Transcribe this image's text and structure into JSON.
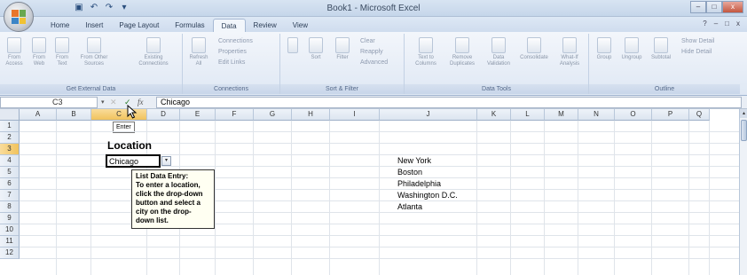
{
  "window": {
    "title": "Book1 - Microsoft Excel",
    "controls": [
      "–",
      "□",
      "x"
    ]
  },
  "quick_access": [
    {
      "icon": "save-icon",
      "glyph": "▣"
    },
    {
      "icon": "undo-icon",
      "glyph": "↶"
    },
    {
      "icon": "redo-icon",
      "glyph": "↷"
    },
    {
      "icon": "customize-icon",
      "glyph": "▾"
    }
  ],
  "tabs": [
    "Home",
    "Insert",
    "Page Layout",
    "Formulas",
    "Data",
    "Review",
    "View"
  ],
  "active_tab": "Data",
  "help_controls": [
    "?",
    "–",
    "□",
    "x"
  ],
  "ribbon": {
    "get_external": {
      "label": "Get External Data",
      "buttons": [
        "From Access",
        "From Web",
        "From Text",
        "From Other Sources",
        "Existing Connections"
      ]
    },
    "connections": {
      "label": "Connections",
      "refresh": "Refresh All",
      "items": [
        "Connections",
        "Properties",
        "Edit Links"
      ]
    },
    "sort_filter": {
      "label": "Sort & Filter",
      "sort": "Sort",
      "filter": "Filter",
      "items": [
        "Clear",
        "Reapply",
        "Advanced"
      ]
    },
    "data_tools": {
      "label": "Data Tools",
      "buttons": [
        "Text to Columns",
        "Remove Duplicates",
        "Data Validation",
        "Consolidate",
        "What-If Analysis"
      ]
    },
    "outline": {
      "label": "Outline",
      "buttons": [
        "Group",
        "Ungroup",
        "Subtotal"
      ],
      "items": [
        "Show Detail",
        "Hide Detail"
      ]
    }
  },
  "formula_bar": {
    "name_box": "C3",
    "cancel": "✕",
    "enter": "✓",
    "fx": "fx",
    "content": "Chicago",
    "enter_tooltip": "Enter"
  },
  "grid": {
    "columns": [
      "A",
      "B",
      "C",
      "D",
      "E",
      "F",
      "G",
      "H",
      "I",
      "J",
      "K",
      "L",
      "M",
      "N",
      "O",
      "P",
      "Q"
    ],
    "rows": [
      "1",
      "2",
      "3",
      "4",
      "5",
      "6",
      "7",
      "8",
      "9",
      "10",
      "11",
      "12"
    ],
    "selected_column": "C",
    "selected_row": "3",
    "heading": "Location",
    "active_cell_value": "Chicago",
    "cities": [
      "New York",
      "Boston",
      "Philadelphia",
      "Washington D.C.",
      "Atlanta"
    ],
    "input_message": {
      "title": "List Data Entry:",
      "lines": [
        "To enter a location,",
        "click the drop-down",
        "button and select a",
        "city on the drop-",
        "down list."
      ]
    }
  }
}
